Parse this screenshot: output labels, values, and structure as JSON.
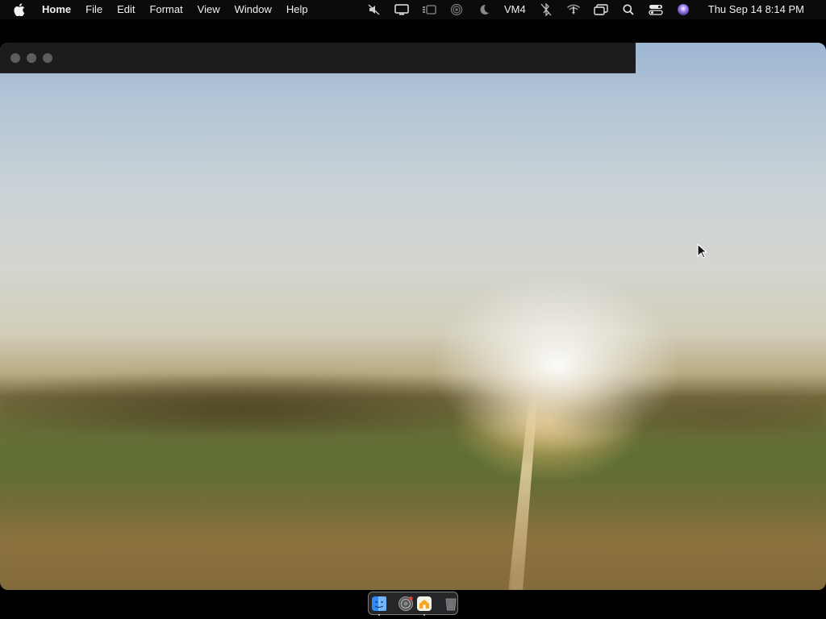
{
  "menubar": {
    "apple_icon": "apple-logo-icon",
    "app_name": "Home",
    "menus": [
      "File",
      "Edit",
      "Format",
      "View",
      "Window",
      "Help"
    ],
    "status_icons": [
      "muted-speaker-icon",
      "display-icon",
      "stage-manager-icon",
      "airdrop-icon",
      "focus-moon-icon"
    ],
    "vm_label": "VM4",
    "status_icons_2": [
      "bluetooth-off-icon",
      "wifi-icon",
      "screen-mirroring-icon",
      "spotlight-search-icon",
      "control-center-icon",
      "siri-icon"
    ],
    "clock": "Thu Sep 14  8:14 PM"
  },
  "window": {
    "traffic_lights": [
      "close",
      "minimize",
      "zoom"
    ],
    "traffic_light_color": "#5d5d60"
  },
  "dock": {
    "items": [
      {
        "name": "finder-icon",
        "running": true
      },
      {
        "name": "siri-settings-icon",
        "running": false
      },
      {
        "name": "home-app-icon",
        "running": true
      },
      {
        "name": "trash-icon",
        "running": false
      }
    ]
  }
}
